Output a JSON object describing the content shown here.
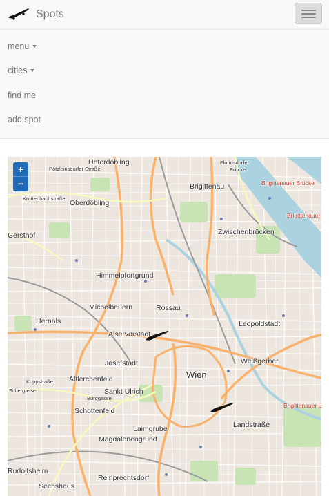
{
  "brand": {
    "name": "Spots",
    "logo_icon": "skateboard-icon"
  },
  "nav": {
    "toggle_icon": "hamburger-icon",
    "items": [
      {
        "label": "menu",
        "dropdown": true
      },
      {
        "label": "cities",
        "dropdown": true
      },
      {
        "label": "find me",
        "dropdown": false
      },
      {
        "label": "add spot",
        "dropdown": false
      }
    ]
  },
  "map": {
    "zoom_in": "+",
    "zoom_out": "−",
    "labels": {
      "unterdobling": "Unterdöbling",
      "floridsdorfer_brucke": "Floridsdorfer",
      "floridsdorfer_brucke2": "Brücke",
      "brigittenau": "Brigittenau",
      "brigittenauer_brucke": "Brigittenauer Brücke",
      "oberdobling": "Oberdöbling",
      "zwischenbrucken": "Zwischenbrücken",
      "brigittenauer_lande": "Brigittenauer Lände",
      "gersthof": "Gersthof",
      "himmelpfortgrund": "Himmelpfortgrund",
      "michelbeuern": "Michelbeuern",
      "rossau": "Rossau",
      "hernals": "Hernals",
      "leopoldstadt": "Leopoldstadt",
      "alservorstadt": "Alservorstadt",
      "weissgerber": "Weißgerber",
      "josefstadt": "Josefstadt",
      "wien": "Wien",
      "altlerchenfeld": "Altlerchenfeld",
      "sankt_ulrich": "Sankt Ulrich",
      "schottenfeld": "Schottenfeld",
      "landstrasse": "Landstraße",
      "laimgrube": "Laimgrube",
      "magdalenengrund": "Magdalenengrund",
      "rudolfsheim": "Rudolfsheim",
      "sechshaus": "Sechshaus",
      "reinprechtsdorf": "Reinprechtsdorf",
      "krottenbachstrasse": "Krottenbachstraße",
      "koppstrasse": "Koppstraße",
      "burggasse": "Burggasse",
      "silbergasse": "Silbergasse",
      "pater_abel": "Pötzleinsdorfer Straße"
    },
    "spot_icon": "skateboard-marker-icon",
    "colors": {
      "primary_road": "#f9b26c",
      "secondary_road": "#f7fabf",
      "water": "#aad3df",
      "park": "#c8e4b4",
      "navbar": "#f8f8f8"
    }
  }
}
